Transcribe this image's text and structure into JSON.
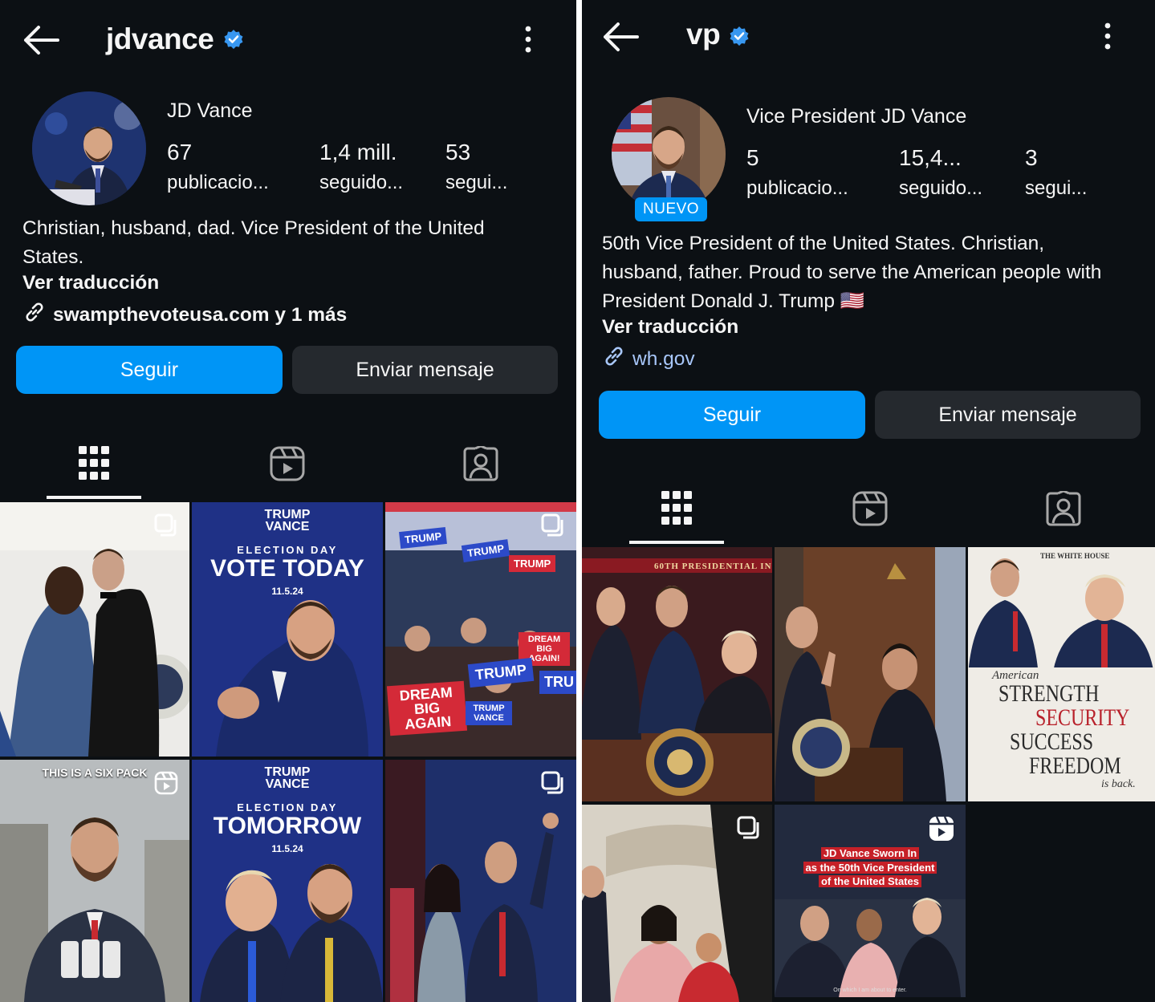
{
  "colors": {
    "background": "#0c1014",
    "accent": "#0095f6",
    "secondary_button": "#25292e",
    "text": "#f5f5f5"
  },
  "left": {
    "header": {
      "username": "jdvance",
      "verified": true
    },
    "profile": {
      "name": "JD Vance",
      "stats": [
        {
          "value": "67",
          "label": "publicacio..."
        },
        {
          "value": "1,4 mill.",
          "label": "seguido..."
        },
        {
          "value": "53",
          "label": "segui..."
        }
      ],
      "bio": "Christian, husband, dad. Vice President of the United States.",
      "translate": "Ver traducción",
      "link": "swampthevoteusa.com y 1 más"
    },
    "buttons": {
      "follow": "Seguir",
      "message": "Enviar mensaje"
    },
    "tabs": [
      "grid-icon",
      "reels-icon",
      "tagged-icon"
    ],
    "grid": {
      "tile2": {
        "top": "ELECTION DAY",
        "main": "VOTE TODAY",
        "date": "11.5.24"
      },
      "tile3_signs": [
        "TRUMP",
        "TRUMP",
        "TRUMP",
        "DREAM BIG AGAIN!",
        "TRUMP",
        "TRU",
        "DREAM BIG AGAIN",
        "TRUMP VANCE"
      ],
      "tile4_caption": "THIS IS A SIX PACK",
      "tile5": {
        "top": "ELECTION DAY",
        "main": "TOMORROW",
        "date": "11.5.24"
      },
      "logo": {
        "line1": "TRUMP",
        "line2": "VANCE"
      }
    }
  },
  "right": {
    "header": {
      "username": "vp",
      "verified": true
    },
    "profile": {
      "name": "Vice President JD Vance",
      "badge": "NUEVO",
      "stats": [
        {
          "value": "5",
          "label": "publicacio..."
        },
        {
          "value": "15,4...",
          "label": "seguido..."
        },
        {
          "value": "3",
          "label": "segui..."
        }
      ],
      "bio": "50th Vice President of the United States. Christian, husband, father. Proud to serve the American people with President Donald J. Trump 🇺🇸",
      "translate": "Ver traducción",
      "link": "wh.gov"
    },
    "buttons": {
      "follow": "Seguir",
      "message": "Enviar mensaje"
    },
    "tabs": [
      "grid-icon",
      "reels-icon",
      "tagged-icon"
    ],
    "grid": {
      "tile1_banner": "60TH PRESIDENTIAL IN",
      "tile3": {
        "header": "THE WHITE HOUSE",
        "script_top": "American",
        "words": [
          "STRENGTH",
          "SECURITY",
          "SUCCESS",
          "FREEDOM"
        ],
        "script_bottom": "is back."
      },
      "tile5": {
        "headline_lines": [
          "JD Vance Sworn In",
          "as the 50th Vice President",
          "of the United States"
        ],
        "caption": "On which I am about to enter."
      }
    }
  }
}
